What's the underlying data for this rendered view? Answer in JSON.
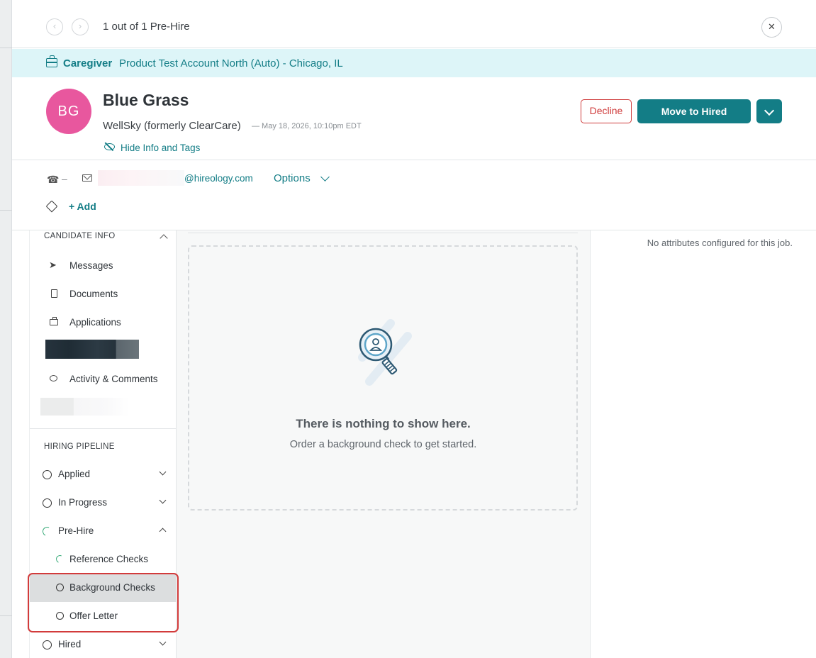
{
  "nav": {
    "prev_icon": "chevron-left-icon",
    "next_icon": "chevron-right-icon",
    "count_text": "1 out of 1 Pre-Hire",
    "close_icon": "close-icon"
  },
  "job": {
    "role": "Caregiver",
    "location": "Product Test Account North (Auto) - Chicago, IL",
    "icon": "briefcase-icon"
  },
  "candidate": {
    "initials": "BG",
    "name": "Blue Grass",
    "company": "WellSky (formerly ClearCare)",
    "date": "— May 18, 2026, 10:10pm EDT",
    "hide_info_label": "Hide Info and Tags",
    "avatar_color": "#e8579e"
  },
  "actions": {
    "decline_label": "Decline",
    "move_label": "Move to Hired"
  },
  "contact": {
    "phone_value": "–",
    "email_domain": "@hireology.com",
    "options_label": "Options",
    "add_tag_label": "+ Add"
  },
  "sidebar": {
    "candidate_info_header": "CANDIDATE INFO",
    "items": [
      {
        "label": "Messages",
        "icon": "send-icon"
      },
      {
        "label": "Documents",
        "icon": "document-icon"
      },
      {
        "label": "Applications",
        "icon": "briefcase-icon"
      },
      {
        "label": "Activity & Comments",
        "icon": "comment-icon"
      }
    ],
    "pipeline_header": "HIRING PIPELINE",
    "stages": [
      {
        "label": "Applied",
        "status": "not-started"
      },
      {
        "label": "In Progress",
        "status": "not-started"
      },
      {
        "label": "Pre-Hire",
        "status": "in-progress"
      },
      {
        "label": "Hired",
        "status": "not-started"
      }
    ],
    "substeps": [
      {
        "label": "Reference Checks",
        "status": "in-progress"
      },
      {
        "label": "Background Checks",
        "status": "not-started",
        "active": true
      },
      {
        "label": "Offer Letter",
        "status": "not-started"
      }
    ]
  },
  "main": {
    "empty_title": "There is nothing to show here.",
    "empty_subtitle": "Order a background check to get started.",
    "illustration_icon": "magnifier-person-icon"
  },
  "attributes": {
    "message": "No attributes configured for this job."
  },
  "colors": {
    "brand": "#137d86",
    "banner_bg": "#ddf5f8",
    "decline": "#cf3b3b",
    "highlight": "#d23b3b",
    "progress": "#31a874"
  }
}
